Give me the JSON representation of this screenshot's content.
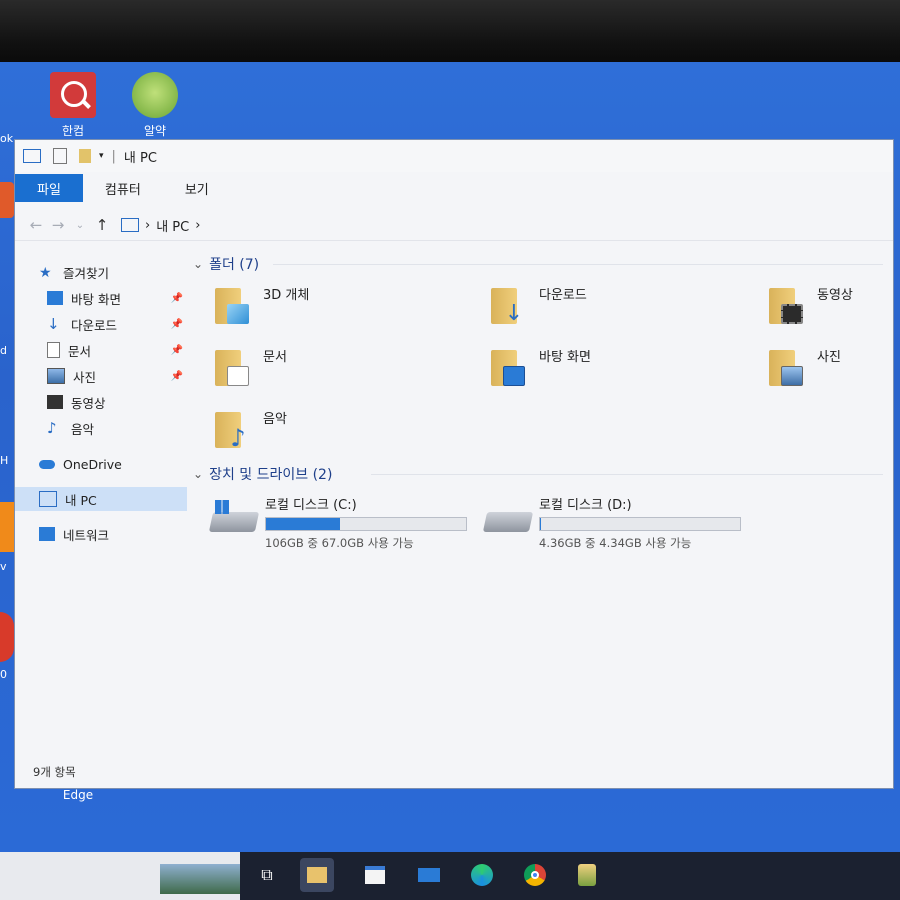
{
  "desktop": {
    "icons": [
      {
        "label": "한컴"
      },
      {
        "label": "알약"
      }
    ],
    "left_edge_labels": [
      "ok",
      "d",
      "H",
      "v",
      "0",
      "Edge"
    ]
  },
  "window": {
    "title": "내 PC",
    "ribbon_tabs": [
      "파일",
      "컴퓨터",
      "보기"
    ],
    "breadcrumb": [
      "내 PC"
    ],
    "nav_pane": {
      "quick_access": "즐겨찾기",
      "items": [
        {
          "label": "바탕 화면",
          "pinned": true
        },
        {
          "label": "다운로드",
          "pinned": true
        },
        {
          "label": "문서",
          "pinned": true
        },
        {
          "label": "사진",
          "pinned": true
        },
        {
          "label": "동영상",
          "pinned": false
        },
        {
          "label": "음악",
          "pinned": false
        }
      ],
      "onedrive": "OneDrive",
      "this_pc": "내 PC",
      "network": "네트워크"
    },
    "folders_header": "폴더 (7)",
    "folders": [
      {
        "label": "3D 개체",
        "icon": "3d-objects-icon"
      },
      {
        "label": "다운로드",
        "icon": "downloads-icon"
      },
      {
        "label": "동영상",
        "icon": "videos-icon"
      },
      {
        "label": "문서",
        "icon": "documents-icon"
      },
      {
        "label": "바탕 화면",
        "icon": "desktop-icon"
      },
      {
        "label": "사진",
        "icon": "pictures-icon"
      },
      {
        "label": "음악",
        "icon": "music-icon"
      }
    ],
    "drives_header": "장치 및 드라이브 (2)",
    "drives": [
      {
        "label": "로컬 디스크 (C:)",
        "space": "106GB 중 67.0GB 사용 가능",
        "used_fraction": 0.37
      },
      {
        "label": "로컬 디스크 (D:)",
        "space": "4.36GB 중 4.34GB 사용 가능",
        "used_fraction": 0.005
      }
    ],
    "status": "9개 항목"
  },
  "colors": {
    "accent": "#1a6fd0",
    "desktop": "#2b6ad6",
    "taskbar": "#1b2130",
    "folder": "#e8c26c",
    "drive_bar": "#2a7bd6"
  }
}
